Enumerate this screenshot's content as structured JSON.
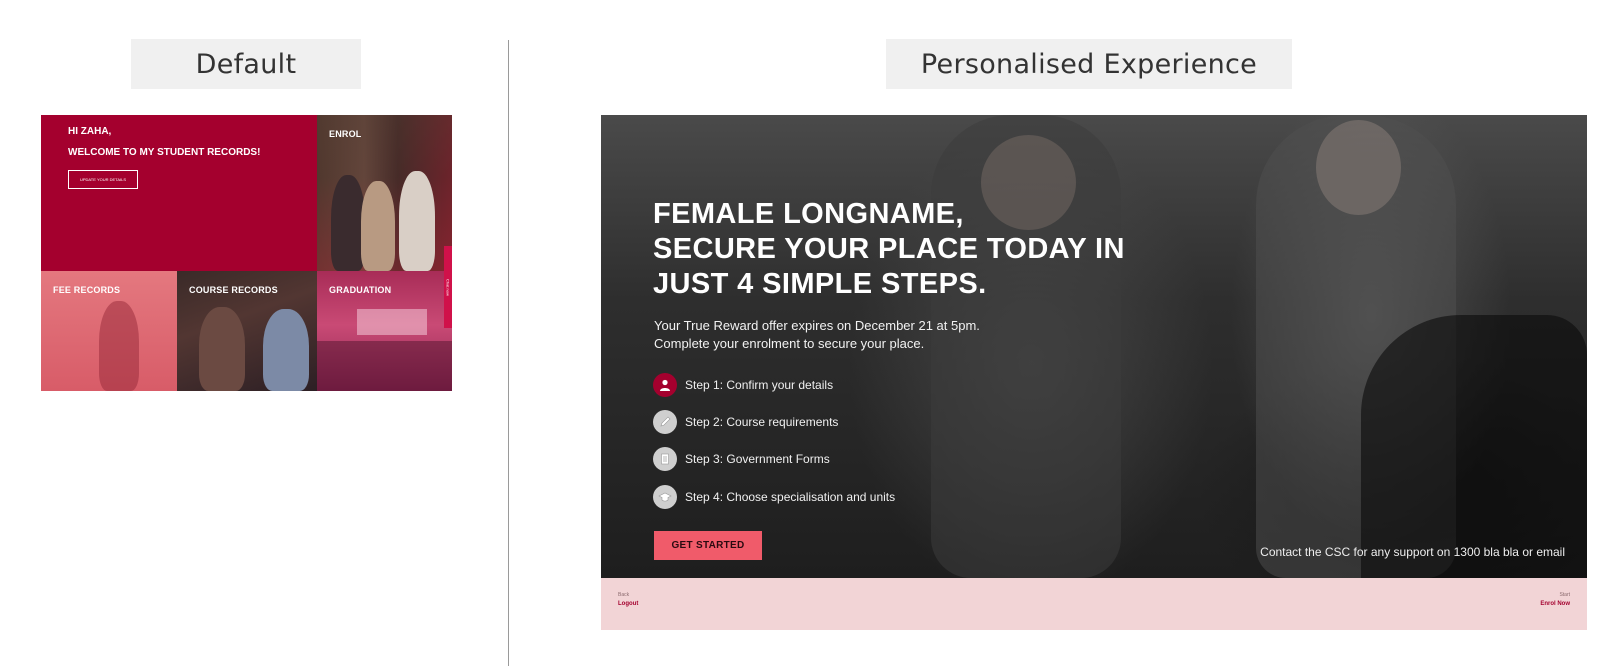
{
  "labels": {
    "default": "Default",
    "personalised": "Personalised Experience"
  },
  "default_mock": {
    "greeting": "HI ZAHA,",
    "welcome": "WELCOME TO MY STUDENT RECORDS!",
    "update_button": "UPDATE YOUR DETAILS",
    "tiles": {
      "enrol": "ENROL",
      "fee": "FEE RECORDS",
      "course": "COURSE RECORDS",
      "graduation": "GRADUATION"
    },
    "side_tab": "Chat now",
    "colors": {
      "brand": "#a4002e",
      "fee": "#e4787f",
      "graduation": "#c94a75"
    }
  },
  "personalised_mock": {
    "headline": "FEMALE LONGNAME,\nSECURE YOUR PLACE TODAY IN\nJUST 4 SIMPLE STEPS.",
    "offer_line1": "Your True Reward offer expires on December 21 at 5pm.",
    "offer_line2": "Complete your enrolment to secure your place.",
    "steps": [
      {
        "label": "Step 1: Confirm your details",
        "icon": "person-icon",
        "color": "#a4002e"
      },
      {
        "label": "Step 2: Course requirements",
        "icon": "pencil-icon",
        "color": "#cfcfcf"
      },
      {
        "label": "Step 3: Government Forms",
        "icon": "document-icon",
        "color": "#cfcfcf"
      },
      {
        "label": "Step 4: Choose specialisation and units",
        "icon": "graduation-cap-icon",
        "color": "#cfcfcf"
      }
    ],
    "cta": "GET STARTED",
    "contact": "Contact the CSC for any support on 1300 bla bla or email",
    "footer": {
      "back_small": "Back",
      "back_link": "Logout",
      "next_small": "Start",
      "next_link": "Enrol Now"
    },
    "colors": {
      "cta": "#f05b6a",
      "footer": "#f2d4d6",
      "link": "#a4002e"
    }
  }
}
